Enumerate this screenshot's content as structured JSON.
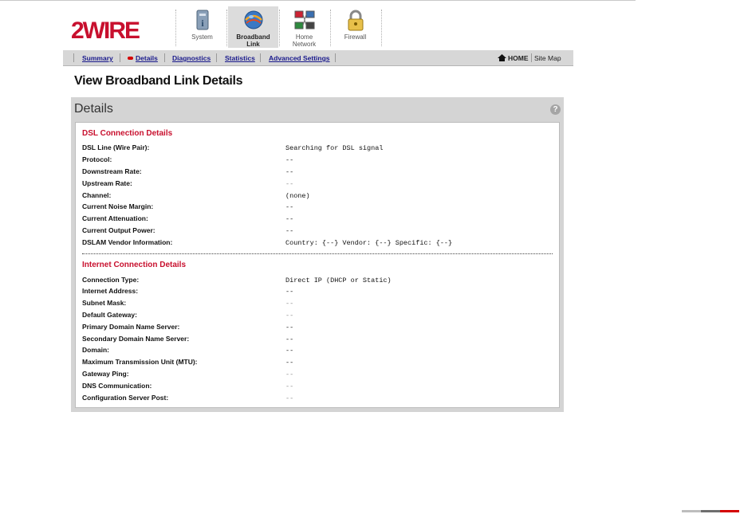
{
  "colors": {
    "accent": "#c8102e",
    "link": "#1a1a8c"
  },
  "brand": {
    "logo_text": "2WIRE"
  },
  "tabs": [
    {
      "label1": "System",
      "label2": "",
      "icon": "system-icon"
    },
    {
      "label1": "Broadband",
      "label2": "Link",
      "icon": "broadband-globe-icon"
    },
    {
      "label1": "Home",
      "label2": "Network",
      "icon": "home-network-icon"
    },
    {
      "label1": "Firewall",
      "label2": "",
      "icon": "firewall-lock-icon"
    }
  ],
  "subnav": {
    "items": [
      "Summary",
      "Details",
      "Diagnostics",
      "Statistics",
      "Advanced Settings"
    ],
    "home": "HOME",
    "sitemap": "Site Map"
  },
  "page": {
    "title": "View Broadband Link Details"
  },
  "panel": {
    "title": "Details",
    "help": "?"
  },
  "dsl": {
    "heading": "DSL Connection Details",
    "rows": [
      {
        "k": "DSL Line (Wire Pair):",
        "v": "Searching for DSL signal"
      },
      {
        "k": "Protocol:",
        "v": "--"
      },
      {
        "k": "Downstream Rate:",
        "v": "--"
      },
      {
        "k": "Upstream Rate:",
        "v": "--"
      },
      {
        "k": "Channel:",
        "v": "(none)"
      },
      {
        "k": "Current Noise Margin:",
        "v": "--"
      },
      {
        "k": "Current Attenuation:",
        "v": "--"
      },
      {
        "k": "Current Output Power:",
        "v": "--"
      },
      {
        "k": "DSLAM Vendor Information:",
        "v": "Country: {--} Vendor: {--} Specific: {--}"
      }
    ]
  },
  "internet": {
    "heading": "Internet Connection Details",
    "rows": [
      {
        "k": "Connection Type:",
        "v": "Direct IP (DHCP or Static)"
      },
      {
        "k": "Internet Address:",
        "v": "--"
      },
      {
        "k": "Subnet Mask:",
        "v": "--"
      },
      {
        "k": "Default Gateway:",
        "v": "--"
      },
      {
        "k": "Primary Domain Name Server:",
        "v": "--"
      },
      {
        "k": "Secondary Domain Name Server:",
        "v": "--"
      },
      {
        "k": "Domain:",
        "v": "--"
      },
      {
        "k": "Maximum Transmission Unit (MTU):",
        "v": "--"
      },
      {
        "k": "Gateway Ping:",
        "v": "--"
      },
      {
        "k": "DNS Communication:",
        "v": "--"
      },
      {
        "k": "Configuration Server Post:",
        "v": "--"
      }
    ]
  }
}
